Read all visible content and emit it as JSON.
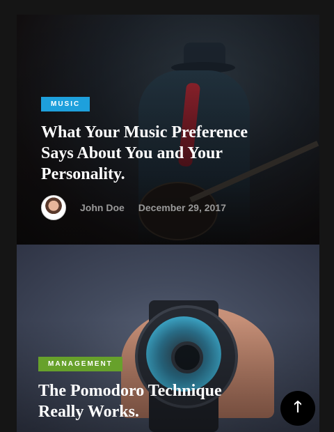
{
  "posts": [
    {
      "category": "MUSIC",
      "category_color": "#1ea0dc",
      "title": "What Your Music Preference Says About You and Your Personality.",
      "author": "John Doe",
      "date": "December 29, 2017"
    },
    {
      "category": "MANAGEMENT",
      "category_color": "#67a12b",
      "title": "The Pomodoro Technique Really Works."
    }
  ],
  "scroll_top": {
    "icon": "arrow-up-icon",
    "glyph": "🡑"
  }
}
